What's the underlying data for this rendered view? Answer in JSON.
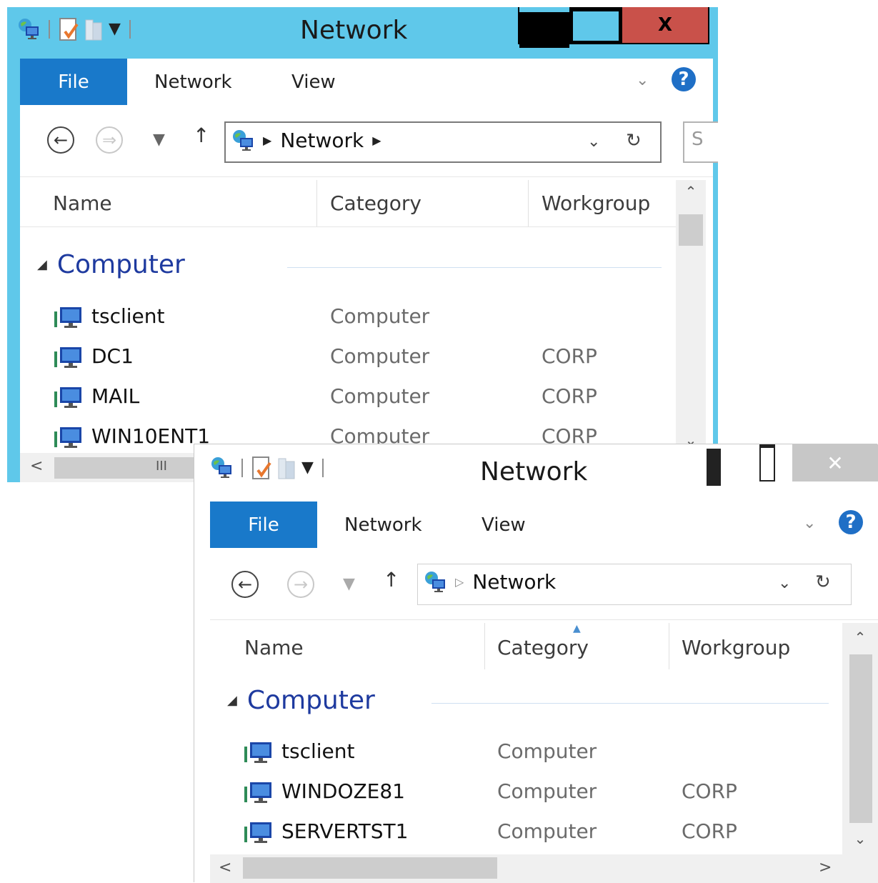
{
  "window1": {
    "title": "Network",
    "ribbon": {
      "file": "File",
      "network": "Network",
      "view": "View",
      "help": "?"
    },
    "address": {
      "crumb": "Network"
    },
    "search_placeholder": "S",
    "columns": {
      "name": "Name",
      "category": "Category",
      "workgroup": "Workgroup"
    },
    "group": "Computer",
    "rows": [
      {
        "name": "tsclient",
        "category": "Computer",
        "workgroup": ""
      },
      {
        "name": "DC1",
        "category": "Computer",
        "workgroup": "CORP"
      },
      {
        "name": "MAIL",
        "category": "Computer",
        "workgroup": "CORP"
      },
      {
        "name": "WIN10ENT1",
        "category": "Computer",
        "workgroup": "CORP"
      }
    ],
    "hscroll_marker": "III"
  },
  "window2": {
    "title": "Network",
    "ribbon": {
      "file": "File",
      "network": "Network",
      "view": "View",
      "help": "?"
    },
    "address": {
      "crumb": "Network"
    },
    "columns": {
      "name": "Name",
      "category": "Category",
      "workgroup": "Workgroup"
    },
    "group": "Computer",
    "rows": [
      {
        "name": "tsclient",
        "category": "Computer",
        "workgroup": ""
      },
      {
        "name": "WINDOZE81",
        "category": "Computer",
        "workgroup": "CORP"
      },
      {
        "name": "SERVERTST1",
        "category": "Computer",
        "workgroup": "CORP"
      }
    ]
  },
  "colors": {
    "ribbon_file_tab": "#1979ca",
    "window1_frame": "#5fc8ea",
    "close_button_1": "#c9514a",
    "group_header": "#1e3a9f"
  }
}
